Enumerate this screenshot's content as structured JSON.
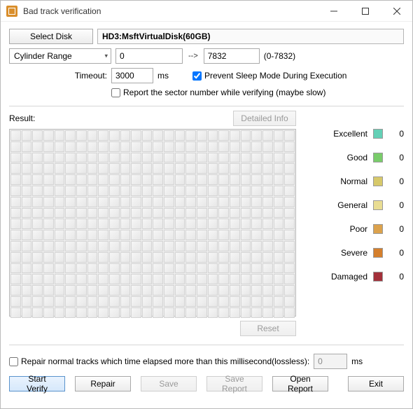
{
  "window": {
    "title": "Bad track verification"
  },
  "toolbar": {
    "select_disk": "Select Disk",
    "disk_name": "HD3:MsftVirtualDisk(60GB)"
  },
  "range": {
    "mode_label": "Cylinder Range",
    "start": "0",
    "end": "7832",
    "hint": "(0-7832)"
  },
  "timeout": {
    "label": "Timeout:",
    "value": "3000",
    "unit": "ms"
  },
  "options": {
    "prevent_sleep": "Prevent Sleep Mode During Execution",
    "report_sector": "Report the sector number while verifying (maybe slow)"
  },
  "result": {
    "label": "Result:",
    "detailed_info": "Detailed Info",
    "reset": "Reset"
  },
  "legend": {
    "excellent": {
      "label": "Excellent",
      "count": "0",
      "color": "#63d0b6"
    },
    "good": {
      "label": "Good",
      "count": "0",
      "color": "#79cc6a"
    },
    "normal": {
      "label": "Normal",
      "count": "0",
      "color": "#d7c96a"
    },
    "general": {
      "label": "General",
      "count": "0",
      "color": "#e9dd93"
    },
    "poor": {
      "label": "Poor",
      "count": "0",
      "color": "#dca24c"
    },
    "severe": {
      "label": "Severe",
      "count": "0",
      "color": "#d57f2c"
    },
    "damaged": {
      "label": "Damaged",
      "count": "0",
      "color": "#a3303a"
    }
  },
  "repair": {
    "label": "Repair normal tracks which time elapsed more than this millisecond(lossless):",
    "value": "0",
    "unit": "ms"
  },
  "buttons": {
    "start": "Start Verify",
    "repair": "Repair",
    "save": "Save",
    "save_report": "Save Report",
    "open_report": "Open Report",
    "exit": "Exit"
  }
}
